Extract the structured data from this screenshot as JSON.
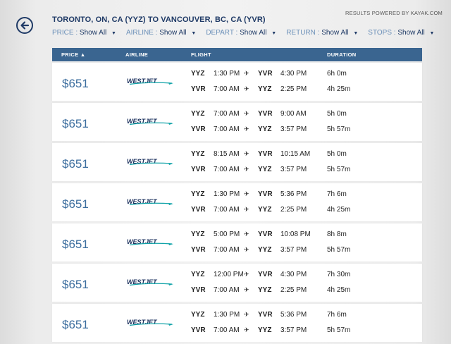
{
  "header": {
    "title": "TORONTO, ON, CA (YYZ) TO VANCOUVER, BC, CA (YVR)",
    "powered_by": "RESULTS POWERED BY KAYAK.COM"
  },
  "filters": [
    {
      "label": "PRICE :",
      "value": "Show All"
    },
    {
      "label": "AIRLINE :",
      "value": "Show All"
    },
    {
      "label": "DEPART :",
      "value": "Show All"
    },
    {
      "label": "RETURN :",
      "value": "Show All"
    },
    {
      "label": "STOPS :",
      "value": "Show All"
    }
  ],
  "columns": {
    "price": "PRICE ▲",
    "airline": "AIRLINE",
    "flight": "FLIGHT",
    "duration": "DURATION"
  },
  "colors": {
    "accent": "#3a6590",
    "price": "#3b6d9e",
    "westjet_teal": "#11a3a8",
    "westjet_navy": "#1a2f5c"
  },
  "results": [
    {
      "price": "$651",
      "airline": "WESTJET",
      "out": {
        "from": "YYZ",
        "dep": "1:30 PM",
        "to": "YVR",
        "arr": "4:30 PM",
        "duration": "6h 0m"
      },
      "ret": {
        "from": "YVR",
        "dep": "7:00 AM",
        "to": "YYZ",
        "arr": "2:25 PM",
        "duration": "4h 25m"
      }
    },
    {
      "price": "$651",
      "airline": "WESTJET",
      "out": {
        "from": "YYZ",
        "dep": "7:00 AM",
        "to": "YVR",
        "arr": "9:00 AM",
        "duration": "5h 0m"
      },
      "ret": {
        "from": "YVR",
        "dep": "7:00 AM",
        "to": "YYZ",
        "arr": "3:57 PM",
        "duration": "5h 57m"
      }
    },
    {
      "price": "$651",
      "airline": "WESTJET",
      "out": {
        "from": "YYZ",
        "dep": "8:15 AM",
        "to": "YVR",
        "arr": "10:15 AM",
        "duration": "5h 0m"
      },
      "ret": {
        "from": "YVR",
        "dep": "7:00 AM",
        "to": "YYZ",
        "arr": "3:57 PM",
        "duration": "5h 57m"
      }
    },
    {
      "price": "$651",
      "airline": "WESTJET",
      "out": {
        "from": "YYZ",
        "dep": "1:30 PM",
        "to": "YVR",
        "arr": "5:36 PM",
        "duration": "7h 6m"
      },
      "ret": {
        "from": "YVR",
        "dep": "7:00 AM",
        "to": "YYZ",
        "arr": "2:25 PM",
        "duration": "4h 25m"
      }
    },
    {
      "price": "$651",
      "airline": "WESTJET",
      "out": {
        "from": "YYZ",
        "dep": "5:00 PM",
        "to": "YVR",
        "arr": "10:08 PM",
        "duration": "8h 8m"
      },
      "ret": {
        "from": "YVR",
        "dep": "7:00 AM",
        "to": "YYZ",
        "arr": "3:57 PM",
        "duration": "5h 57m"
      }
    },
    {
      "price": "$651",
      "airline": "WESTJET",
      "out": {
        "from": "YYZ",
        "dep": "12:00 PM",
        "to": "YVR",
        "arr": "4:30 PM",
        "duration": "7h 30m"
      },
      "ret": {
        "from": "YVR",
        "dep": "7:00 AM",
        "to": "YYZ",
        "arr": "2:25 PM",
        "duration": "4h 25m"
      }
    },
    {
      "price": "$651",
      "airline": "WESTJET",
      "out": {
        "from": "YYZ",
        "dep": "1:30 PM",
        "to": "YVR",
        "arr": "5:36 PM",
        "duration": "7h 6m"
      },
      "ret": {
        "from": "YVR",
        "dep": "7:00 AM",
        "to": "YYZ",
        "arr": "3:57 PM",
        "duration": "5h 57m"
      }
    }
  ]
}
